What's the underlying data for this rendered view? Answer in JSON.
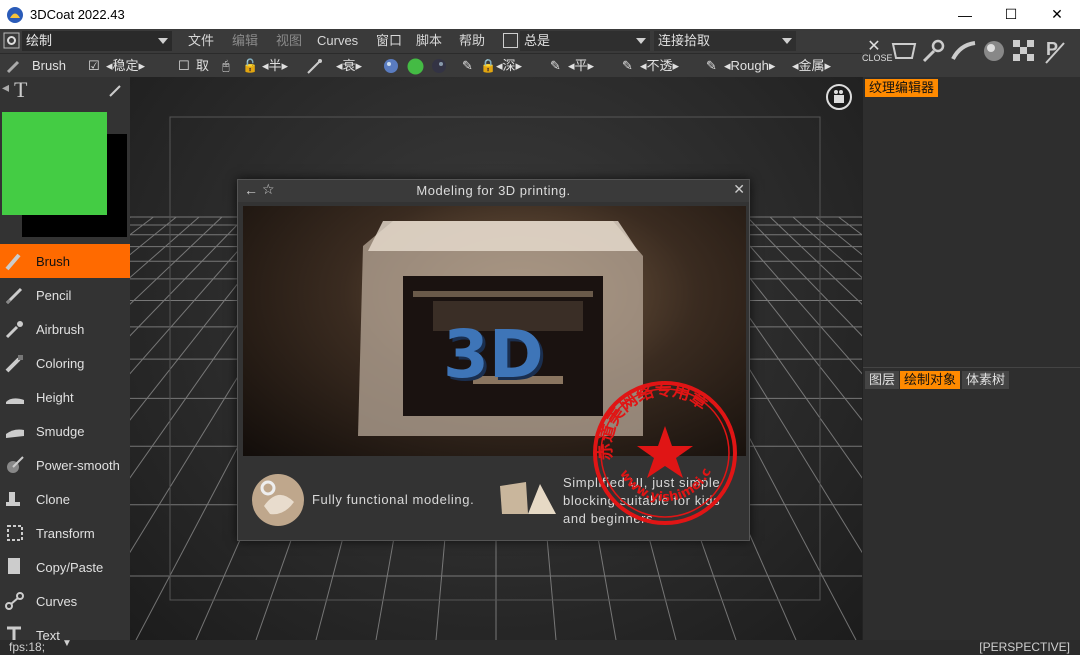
{
  "window": {
    "title": "3DCoat 2022.43",
    "minimize": "—",
    "maximize": "☐",
    "close": "✕"
  },
  "toolbar": {
    "mode": "绘制",
    "menus": [
      "文件",
      "编辑",
      "视图",
      "Curves",
      "窗口",
      "脚本",
      "帮助"
    ],
    "always_label": "总是",
    "pick_label": "连接拾取",
    "brush_label": "Brush",
    "stabilize": "◂稳定▸",
    "cancel_label": "取",
    "half": "◂半▸",
    "decay": "◂衰▸",
    "depth": "◂深▸",
    "flat": "◂平▸",
    "opacity": "◂不透▸",
    "rough": "◂Rough▸",
    "metal": "◂金属▸",
    "close_label": "CLOSE"
  },
  "tools": [
    {
      "label": "Brush",
      "icon": "brush-icon"
    },
    {
      "label": "Pencil",
      "icon": "pencil-icon"
    },
    {
      "label": "Airbrush",
      "icon": "airbrush-icon"
    },
    {
      "label": "Coloring",
      "icon": "coloring-icon"
    },
    {
      "label": "Height",
      "icon": "height-icon"
    },
    {
      "label": "Smudge",
      "icon": "smudge-icon"
    },
    {
      "label": "Power-smooth",
      "icon": "power-smooth-icon"
    },
    {
      "label": "Clone",
      "icon": "clone-icon"
    },
    {
      "label": "Transform",
      "icon": "transform-icon"
    },
    {
      "label": "Copy/Paste",
      "icon": "copy-paste-icon"
    },
    {
      "label": "Curves",
      "icon": "curves-icon"
    },
    {
      "label": "Text",
      "icon": "text-icon"
    }
  ],
  "right_panel": {
    "top_tab": "纹理编辑器",
    "tabs": [
      "图层",
      "绘制对象",
      "体素树"
    ]
  },
  "dialog": {
    "title": "Modeling  for  3D  printing.",
    "image_text": "3D",
    "feature1": "Fully  functional  modeling.",
    "feature2_lines": [
      "Simplified  UI,  just  simple",
      "blocking  suitable  for  kids",
      "and  beginners."
    ]
  },
  "status": {
    "fps": "fps:18;",
    "view": "[PERSPECTIVE]"
  },
  "stamp": {
    "top_text": "赤道美网络专用章",
    "bottom_text": "www.yishimei.cn"
  },
  "colors": {
    "accent": "#ff6a00",
    "primary_color": "#44cc44",
    "secondary_color": "#000000",
    "stamp_red": "#e01515"
  }
}
